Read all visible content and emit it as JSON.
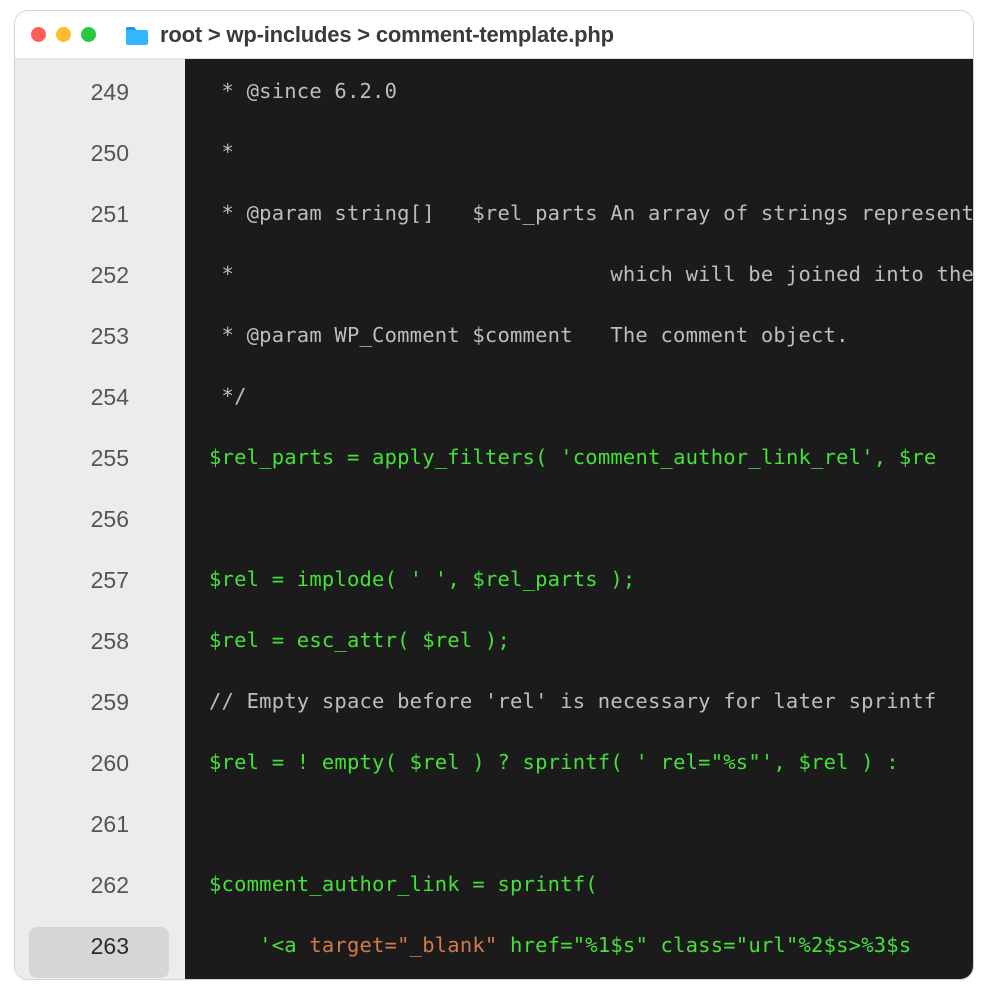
{
  "breadcrumb": "root > wp-includes > comment-template.php",
  "active_line": 263,
  "lines": [
    {
      "n": 249,
      "segs": [
        {
          "t": " * @since 6.2.0",
          "c": "c-comment"
        }
      ]
    },
    {
      "n": 250,
      "segs": [
        {
          "t": " *",
          "c": "c-comment"
        }
      ]
    },
    {
      "n": 251,
      "segs": [
        {
          "t": " * @param string[]   $rel_parts An array of strings represent",
          "c": "c-comment"
        }
      ]
    },
    {
      "n": 252,
      "segs": [
        {
          "t": " *                              which will be joined into the",
          "c": "c-comment"
        }
      ]
    },
    {
      "n": 253,
      "segs": [
        {
          "t": " * @param WP_Comment $comment   The comment object.",
          "c": "c-comment"
        }
      ]
    },
    {
      "n": 254,
      "segs": [
        {
          "t": " */",
          "c": "c-comment"
        }
      ]
    },
    {
      "n": 255,
      "segs": [
        {
          "t": "$rel_parts = apply_filters( ",
          "c": "c-green"
        },
        {
          "t": "'comment_author_link_rel'",
          "c": "c-green"
        },
        {
          "t": ", $re",
          "c": "c-green"
        }
      ]
    },
    {
      "n": 256,
      "segs": [
        {
          "t": "",
          "c": "c-white"
        }
      ]
    },
    {
      "n": 257,
      "segs": [
        {
          "t": "$rel = implode( ",
          "c": "c-green"
        },
        {
          "t": "' '",
          "c": "c-green"
        },
        {
          "t": ", $rel_parts );",
          "c": "c-green"
        }
      ]
    },
    {
      "n": 258,
      "segs": [
        {
          "t": "$rel = esc_attr( $rel );",
          "c": "c-green"
        }
      ]
    },
    {
      "n": 259,
      "segs": [
        {
          "t": "// Empty space before 'rel' is necessary for later sprintf",
          "c": "c-comment"
        }
      ]
    },
    {
      "n": 260,
      "segs": [
        {
          "t": "$rel = ! empty( $rel ) ? sprintf( ",
          "c": "c-green"
        },
        {
          "t": "' rel=\"%s\"'",
          "c": "c-green"
        },
        {
          "t": ", $rel ) :",
          "c": "c-green"
        }
      ]
    },
    {
      "n": 261,
      "segs": [
        {
          "t": "",
          "c": "c-white"
        }
      ]
    },
    {
      "n": 262,
      "segs": [
        {
          "t": "$comment_author_link = sprintf(",
          "c": "c-green"
        }
      ]
    },
    {
      "n": 263,
      "segs": [
        {
          "t": "    '<a ",
          "c": "c-green"
        },
        {
          "t": "target=\"_blank\"",
          "c": "c-brown"
        },
        {
          "t": " href=\"%1$s\" class=\"url\"%2$s>%3$s",
          "c": "c-green"
        }
      ]
    }
  ]
}
